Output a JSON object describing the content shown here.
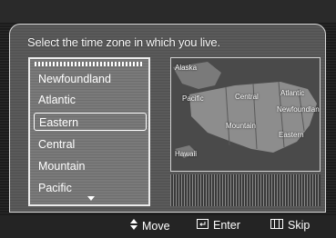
{
  "prompt": "Select the time zone in which you live.",
  "timezones": [
    "Newfoundland",
    "Atlantic",
    "Eastern",
    "Central",
    "Mountain",
    "Pacific"
  ],
  "selected": "Eastern",
  "map": {
    "labels": [
      "Alaska",
      "Pacific",
      "Central",
      "Atlantic",
      "Newfoundland",
      "Mountain",
      "Eastern",
      "Hawaii"
    ]
  },
  "footer": {
    "move": "Move",
    "enter": "Enter",
    "skip": "Skip"
  },
  "colors": {
    "panel": "#5a5a5a",
    "border": "#ffffff",
    "text": "#ffffff"
  }
}
